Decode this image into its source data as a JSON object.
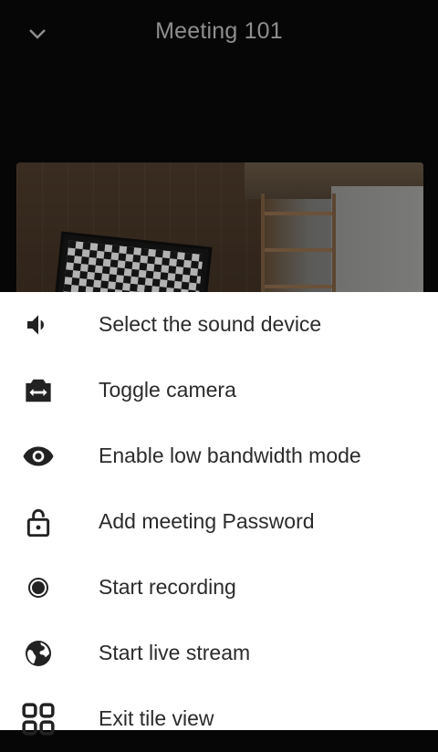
{
  "header": {
    "title": "Meeting 101",
    "back_icon": "chevron-down-icon"
  },
  "menu": {
    "items": [
      {
        "label": "Select the sound device",
        "icon": "volume-icon"
      },
      {
        "label": "Toggle camera",
        "icon": "switch-camera-icon"
      },
      {
        "label": "Enable low bandwidth mode",
        "icon": "eye-icon"
      },
      {
        "label": "Add meeting Password",
        "icon": "lock-open-icon"
      },
      {
        "label": "Start recording",
        "icon": "record-icon"
      },
      {
        "label": "Start live stream",
        "icon": "globe-icon"
      },
      {
        "label": "Exit tile view",
        "icon": "tile-view-icon"
      }
    ]
  },
  "colors": {
    "background": "#060606",
    "sheet": "#ffffff",
    "text": "#2b2b2b",
    "title": "#8e8e8e"
  }
}
